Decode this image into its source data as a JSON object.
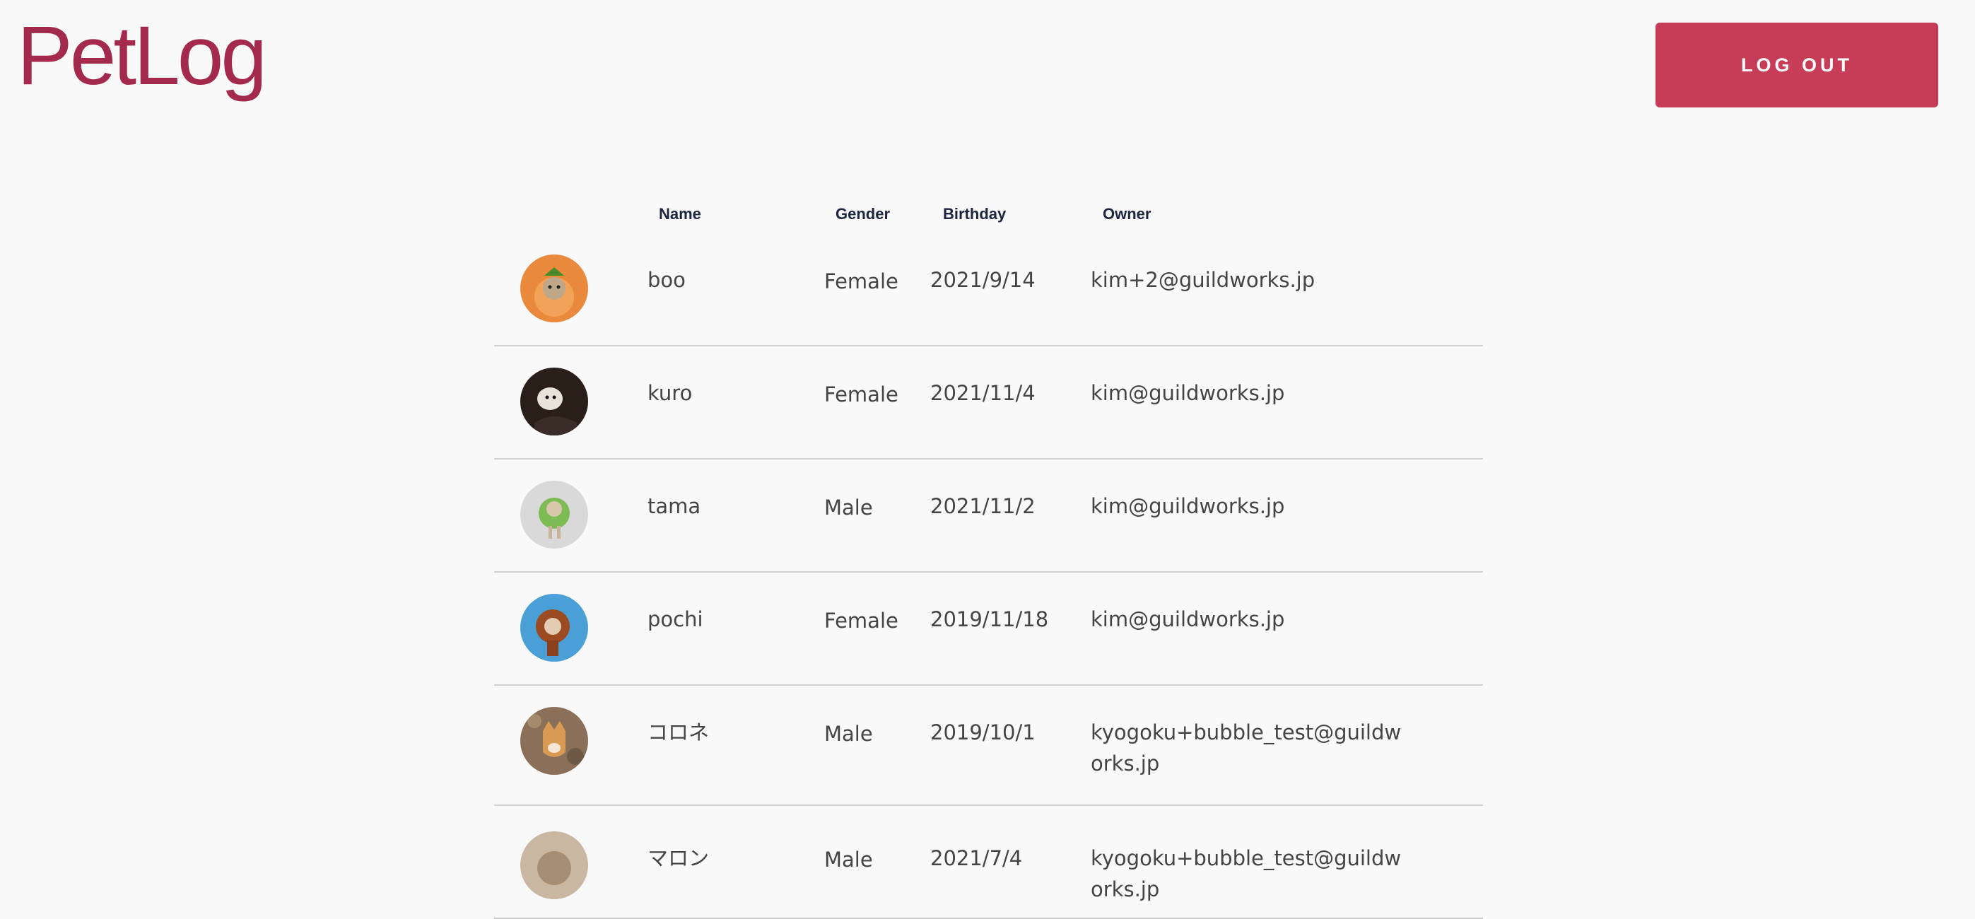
{
  "app": {
    "logo_text": "PetLog",
    "logout_label": "LOG OUT",
    "brand_color": "#a32a4d",
    "button_color": "#c73d58"
  },
  "table": {
    "headers": {
      "name": "Name",
      "gender": "Gender",
      "birthday": "Birthday",
      "owner": "Owner"
    },
    "rows": [
      {
        "name": "boo",
        "gender": "Female",
        "birthday": "2021/9/14",
        "owner": "kim+2@guildworks.jp",
        "avatar_bg": "#ea8a3c"
      },
      {
        "name": "kuro",
        "gender": "Female",
        "birthday": "2021/11/4",
        "owner": "kim@guildworks.jp",
        "avatar_bg": "#2a1e19"
      },
      {
        "name": "tama",
        "gender": "Male",
        "birthday": "2021/11/2",
        "owner": "kim@guildworks.jp",
        "avatar_bg": "#d9d9d9"
      },
      {
        "name": "pochi",
        "gender": "Female",
        "birthday": "2019/11/18",
        "owner": "kim@guildworks.jp",
        "avatar_bg": "#4aa0d6"
      },
      {
        "name": "コロネ",
        "gender": "Male",
        "birthday": "2019/10/1",
        "owner": "kyogoku+bubble_test@guildworks.jp",
        "avatar_bg": "#8a7058"
      },
      {
        "name": "マロン",
        "gender": "Male",
        "birthday": "2021/7/4",
        "owner": "kyogoku+bubble_test@guildworks.jp",
        "avatar_bg": "#c9b7a2"
      }
    ]
  }
}
